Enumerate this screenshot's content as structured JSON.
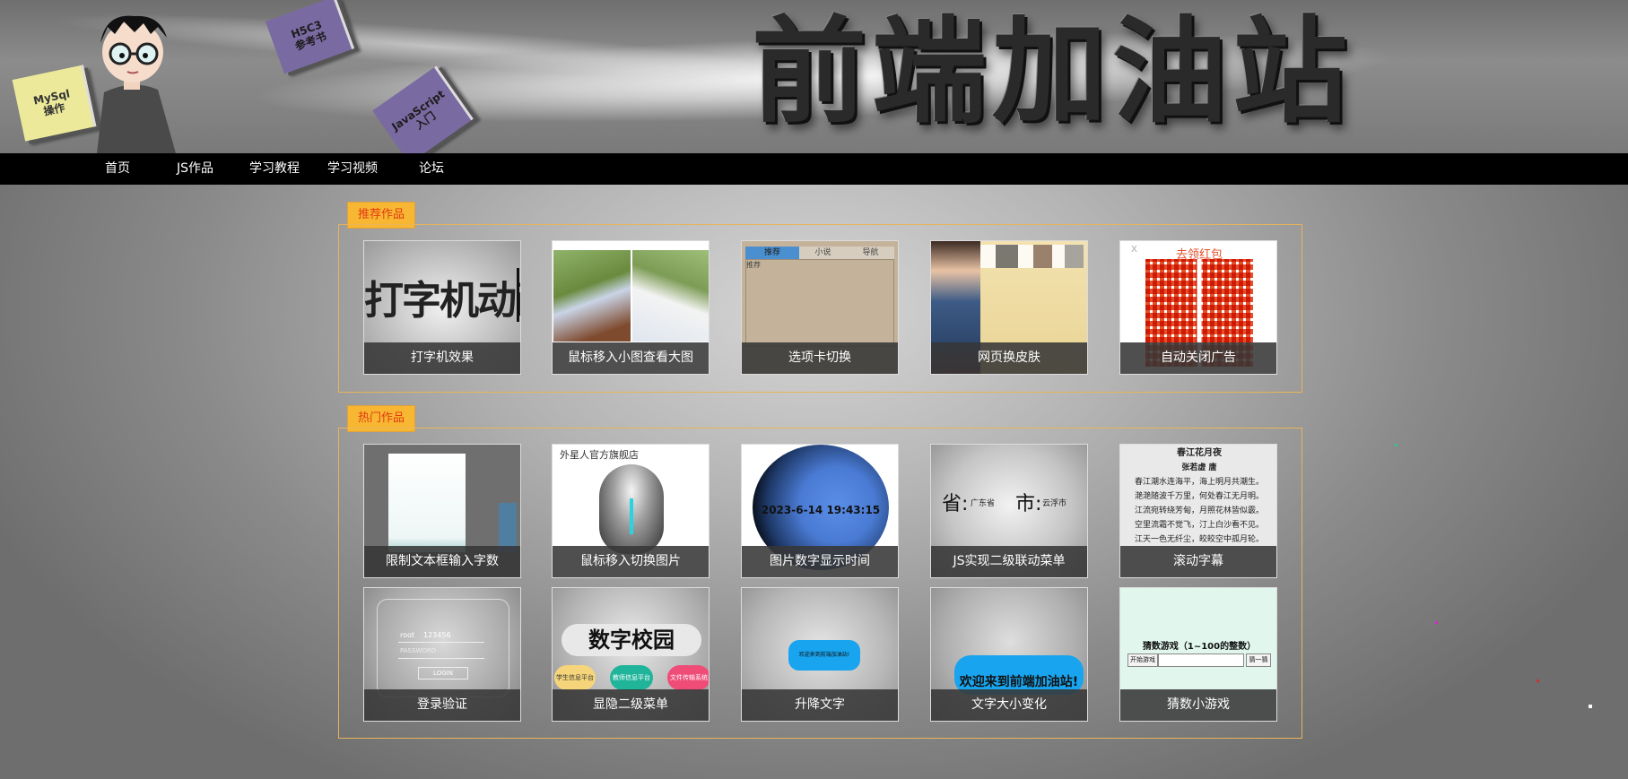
{
  "header": {
    "site_title": "前端加油站",
    "books": {
      "mysql": "MySql\n操作",
      "html5": "H5C3\n参考书",
      "js": "JavaScript\n入门"
    }
  },
  "nav": {
    "items": [
      "首页",
      "JS作品",
      "学习教程",
      "学习视频",
      "论坛"
    ]
  },
  "recommended": {
    "label": "推荐作品",
    "cards": [
      {
        "caption": "打字机效果",
        "thumb_text": "打字机动画"
      },
      {
        "caption": "鼠标移入小图查看大图"
      },
      {
        "caption": "选项卡切换",
        "tabs": [
          "推荐",
          "小说",
          "导航"
        ],
        "sub": "推荐"
      },
      {
        "caption": "网页换皮肤"
      },
      {
        "caption": "自动关闭广告",
        "thumb_text": "去领红包",
        "close": "X"
      }
    ]
  },
  "hot": {
    "label": "热门作品",
    "cards": [
      {
        "caption": "限制文本框输入字数"
      },
      {
        "caption": "鼠标移入切换图片",
        "thumb_text": "外星人官方旗舰店"
      },
      {
        "caption": "图片数字显示时间",
        "thumb_text": "2023-6-14 19:43:15"
      },
      {
        "caption": "JS实现二级联动菜单",
        "sheng": "省:",
        "sheng_val": "广东省",
        "shi": "市:",
        "shi_val": "云浮市"
      },
      {
        "caption": "滚动字幕",
        "poem_title": "春江花月夜",
        "poem_author": "张若虚 唐",
        "poem_lines": [
          "春江潮水连海平，海上明月共潮生。",
          "滟滟随波千万里，何处春江无月明。",
          "江流宛转绕芳甸，月照花林皆似霰。",
          "空里流霜不觉飞，汀上白沙看不见。",
          "江天一色无纤尘，皎皎空中孤月轮。"
        ]
      },
      {
        "caption": "登录验证",
        "user": "root",
        "pass_val": "123456",
        "pass_label": "PASSWORD",
        "login": "LOGIN"
      },
      {
        "caption": "显隐二级菜单",
        "thumb_text": "数字校园",
        "pills": [
          "学生信息平台",
          "教师信息平台",
          "文件传输系统"
        ]
      },
      {
        "caption": "升降文字",
        "thumb_text": "欢迎来到前端加油站!"
      },
      {
        "caption": "文字大小变化",
        "thumb_text": "欢迎来到前端加油站!"
      },
      {
        "caption": "猜数小游戏",
        "thumb_text": "猜数游戏（1~100的整数）",
        "start": "开始游戏",
        "guess": "猜一猜"
      }
    ]
  },
  "colors": {
    "tag_bg": "#f7b733",
    "tag_text": "#e23a11",
    "box_border": "#e9b45a",
    "nav_bg": "#000000"
  }
}
